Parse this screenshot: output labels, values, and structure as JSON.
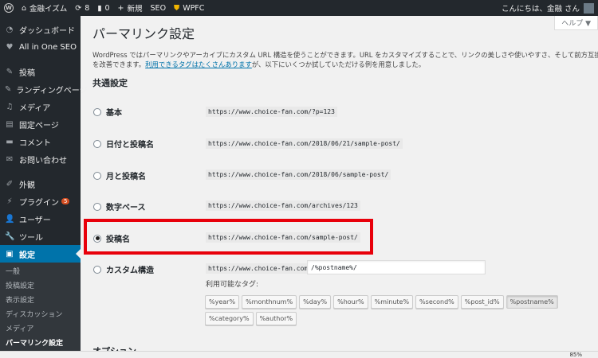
{
  "adminbar": {
    "site_name": "金融イズム",
    "updates": "8",
    "comments": "0",
    "new_label": "新規",
    "seo_label": "SEO",
    "wpfc_label": "WPFC",
    "greeting": "こんにちは、金融 さん"
  },
  "sidebar": {
    "dashboard": "ダッシュボード",
    "aioseo": "All in One SEO",
    "posts": "投稿",
    "landing": "ランディングページ",
    "media": "メディア",
    "pages": "固定ページ",
    "comments": "コメント",
    "contact": "お問い合わせ",
    "appearance": "外観",
    "plugins": "プラグイン",
    "plugins_badge": "5",
    "users": "ユーザー",
    "tools": "ツール",
    "settings": "設定",
    "submenu": [
      "一般",
      "投稿設定",
      "表示設定",
      "ディスカッション",
      "メディア",
      "パーマリンク設定"
    ]
  },
  "page": {
    "help": "ヘルプ ▼",
    "title": "パーマリンク設定",
    "desc_line1": "WordPress ではパーマリンクやアーカイブにカスタム URL 構造を使うことができます。URL をカスタマイズすることで、リンクの美しさや使いやすさ、そして前方互換性",
    "desc_line2_pre": "を改善できます。",
    "desc_link": "利用できるタグはたくさんあります",
    "desc_line2_post": "が、以下にいくつか試していただける例を用意しました。",
    "common_heading": "共通設定",
    "options_heading": "オプション"
  },
  "permalinks": [
    {
      "label": "基本",
      "url": "https://www.choice-fan.com/?p=123",
      "checked": false
    },
    {
      "label": "日付と投稿名",
      "url": "https://www.choice-fan.com/2018/06/21/sample-post/",
      "checked": false
    },
    {
      "label": "月と投稿名",
      "url": "https://www.choice-fan.com/2018/06/sample-post/",
      "checked": false
    },
    {
      "label": "数字ベース",
      "url": "https://www.choice-fan.com/archives/123",
      "checked": false
    },
    {
      "label": "投稿名",
      "url": "https://www.choice-fan.com/sample-post/",
      "checked": true
    },
    {
      "label": "カスタム構造",
      "url": "https://www.choice-fan.com",
      "checked": false
    }
  ],
  "custom": {
    "value": "/%postname%/",
    "tags_label": "利用可能なタグ:",
    "tags": [
      "%year%",
      "%monthnum%",
      "%day%",
      "%hour%",
      "%minute%",
      "%second%",
      "%post_id%",
      "%postname%",
      "%category%",
      "%author%"
    ]
  },
  "statusbar": {
    "zoom": "85%"
  },
  "colors": {
    "accent": "#0073aa",
    "highlight": "#e8000b",
    "sidebar": "#23282d"
  }
}
